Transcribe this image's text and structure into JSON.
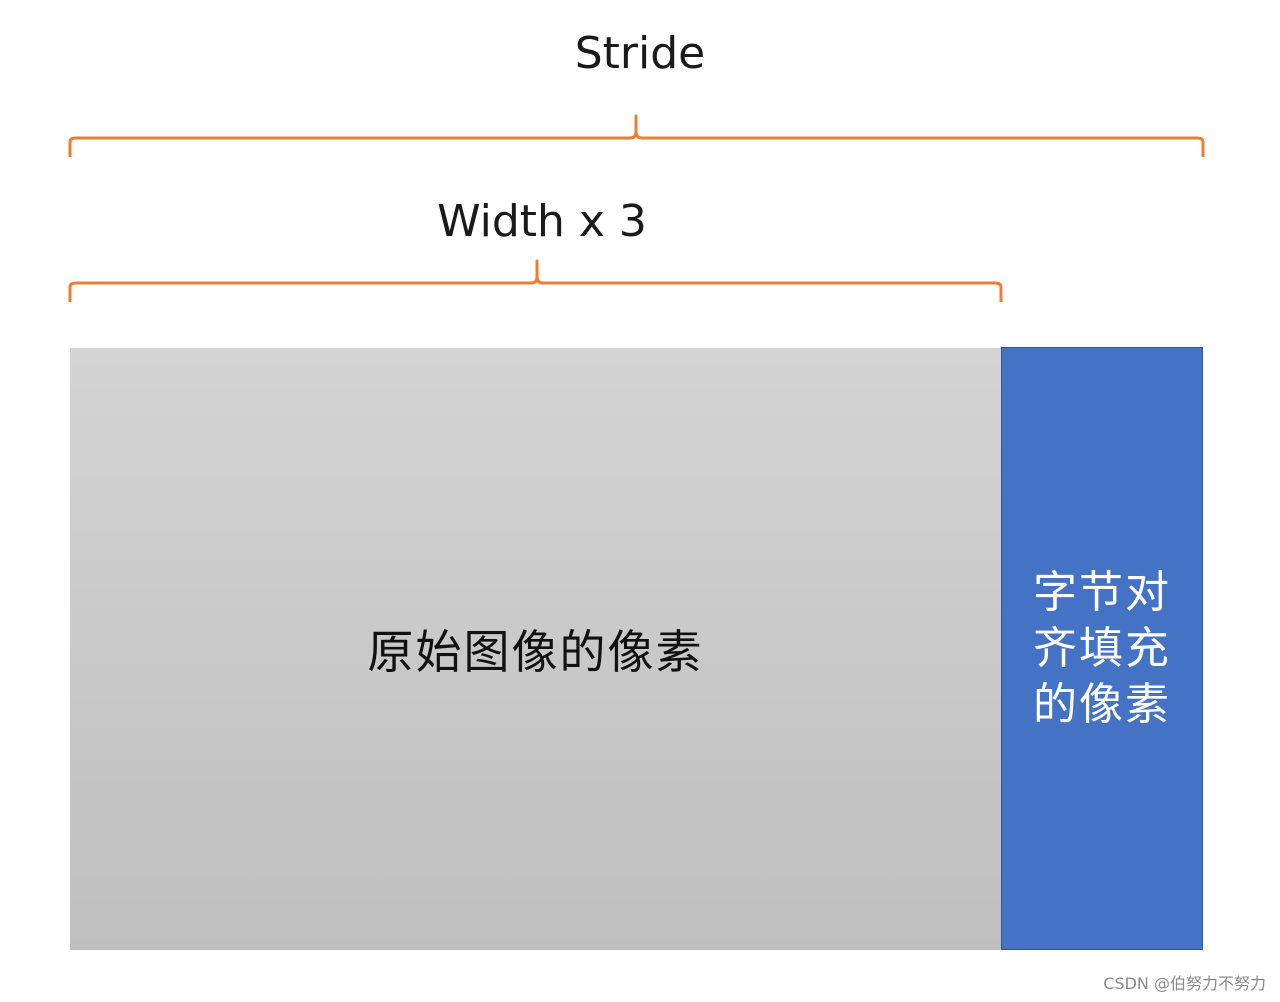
{
  "labels": {
    "stride": "Stride",
    "width": "Width x 3"
  },
  "blocks": {
    "original": "原始图像的像素",
    "padding": "字节对齐填充的像素"
  },
  "watermark": "CSDN @伯努力不努力",
  "colors": {
    "brace": "#ED7D31",
    "padding_block": "#4472C4",
    "original_block": "#C8C8C8"
  }
}
